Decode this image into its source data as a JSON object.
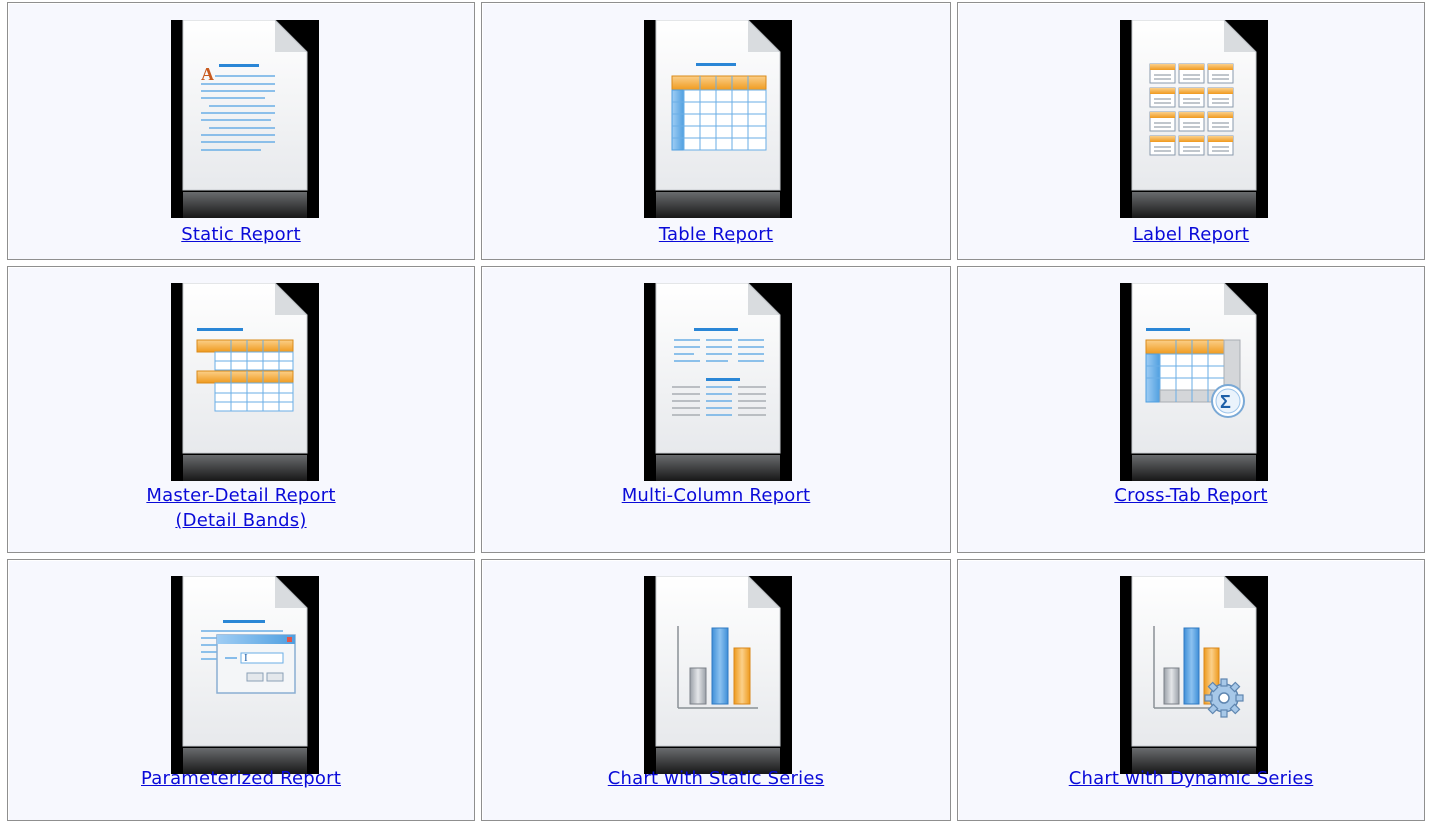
{
  "gallery": {
    "items": [
      {
        "id": "static-report",
        "label": "Static Report",
        "icon": "static-report-icon"
      },
      {
        "id": "table-report",
        "label": "Table Report",
        "icon": "table-report-icon"
      },
      {
        "id": "label-report",
        "label": "Label Report",
        "icon": "label-report-icon"
      },
      {
        "id": "master-detail-report",
        "label": "Master-Detail Report",
        "label_line2": "(Detail Bands)",
        "icon": "master-detail-report-icon"
      },
      {
        "id": "multi-column-report",
        "label": "Multi-Column Report",
        "icon": "multi-column-report-icon"
      },
      {
        "id": "cross-tab-report",
        "label": "Cross-Tab Report",
        "icon": "cross-tab-report-icon"
      },
      {
        "id": "parameterized-report",
        "label": "Parameterized Report",
        "icon": "parameterized-report-icon"
      },
      {
        "id": "chart-static-series",
        "label": "Chart with Static Series",
        "icon": "chart-static-series-icon"
      },
      {
        "id": "chart-dynamic-series",
        "label": "Chart with Dynamic Series",
        "icon": "chart-dynamic-series-icon"
      }
    ]
  },
  "colors": {
    "cell_background": "#f7f8fe",
    "border": "#8f8f8f",
    "link": "#0a0ad8",
    "accent_blue": "#2a86d6",
    "accent_orange": "#f0a12a",
    "icon_background": "#000000"
  }
}
